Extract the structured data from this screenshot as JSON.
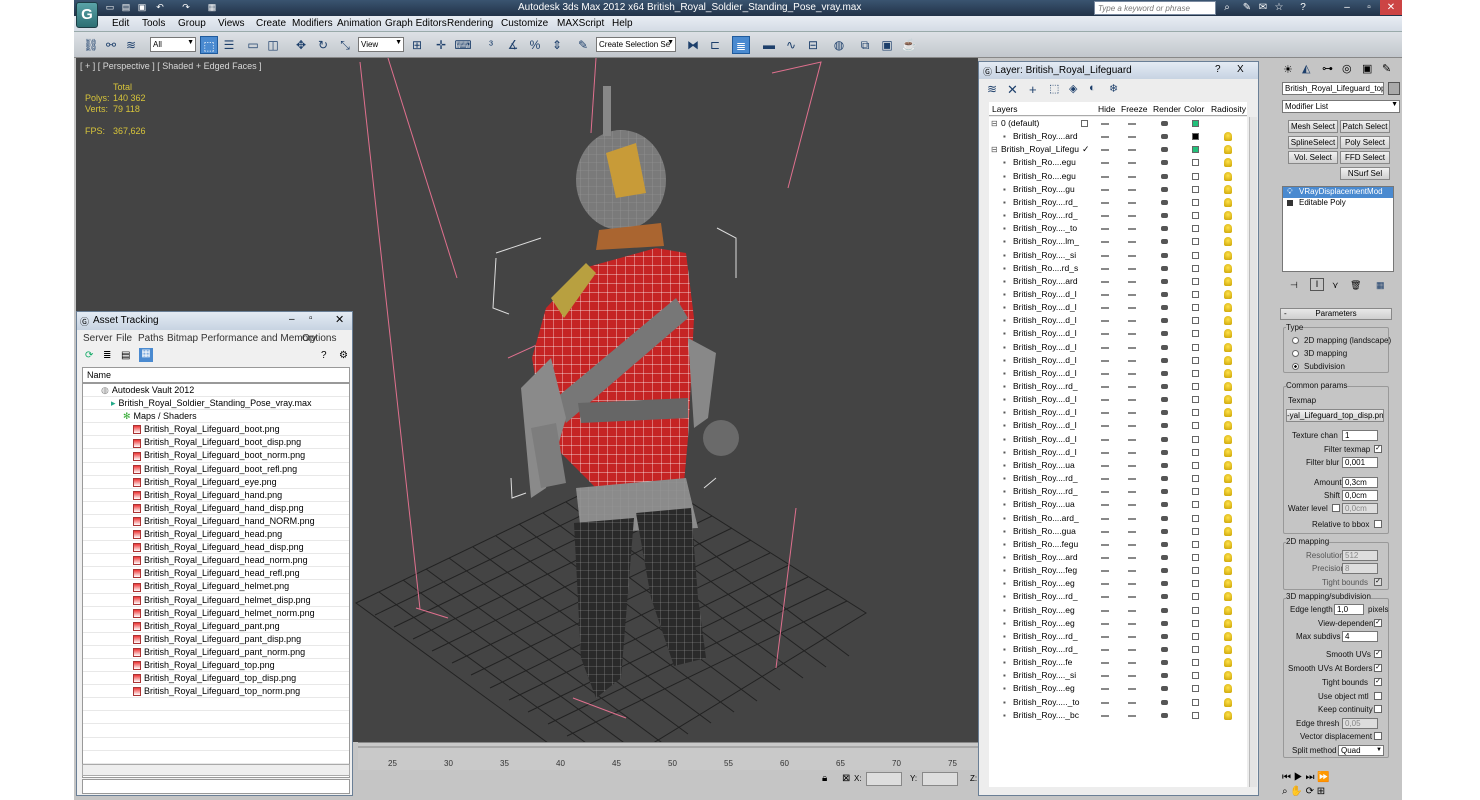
{
  "app": {
    "title": "Autodesk 3ds Max  2012 x64     British_Royal_Soldier_Standing_Pose_vray.max",
    "logo": "G",
    "search_placeholder": "Type a keyword or phrase"
  },
  "menu": [
    "Edit",
    "Tools",
    "Group",
    "Views",
    "Create",
    "Modifiers",
    "Animation",
    "Graph Editors",
    "Rendering",
    "Customize",
    "MAXScript",
    "Help"
  ],
  "toolbar": {
    "filter": "All",
    "coord": "View",
    "selset": "Create Selection Se"
  },
  "viewport": {
    "label": "[ + ] [ Perspective ] [ Shaded + Edged Faces ]",
    "total": "Total",
    "polys_label": "Polys:",
    "polys": "140 362",
    "verts_label": "Verts:",
    "verts": "79 118",
    "fps_label": "FPS:",
    "fps": "367,626"
  },
  "timeline": {
    "ticks": [
      "25",
      "30",
      "35",
      "40",
      "45",
      "50",
      "55",
      "60",
      "65",
      "70",
      "75"
    ]
  },
  "status": {
    "x_label": "X:",
    "y_label": "Y:",
    "z_label": "Z:"
  },
  "asset": {
    "title": "Asset Tracking",
    "menu": [
      "Server",
      "File",
      "Paths",
      "Bitmap Performance and Memory",
      "Options"
    ],
    "col": "Name",
    "vault": "Autodesk Vault 2012",
    "scene": "British_Royal_Soldier_Standing_Pose_vray.max",
    "maps": "Maps / Shaders",
    "files": [
      "British_Royal_Lifeguard_boot.png",
      "British_Royal_Lifeguard_boot_disp.png",
      "British_Royal_Lifeguard_boot_norm.png",
      "British_Royal_Lifeguard_boot_refl.png",
      "British_Royal_Lifeguard_eye.png",
      "British_Royal_Lifeguard_hand.png",
      "British_Royal_Lifeguard_hand_disp.png",
      "British_Royal_Lifeguard_hand_NORM.png",
      "British_Royal_Lifeguard_head.png",
      "British_Royal_Lifeguard_head_disp.png",
      "British_Royal_Lifeguard_head_norm.png",
      "British_Royal_Lifeguard_head_refl.png",
      "British_Royal_Lifeguard_helmet.png",
      "British_Royal_Lifeguard_helmet_disp.png",
      "British_Royal_Lifeguard_helmet_norm.png",
      "British_Royal_Lifeguard_pant.png",
      "British_Royal_Lifeguard_pant_disp.png",
      "British_Royal_Lifeguard_pant_norm.png",
      "British_Royal_Lifeguard_top.png",
      "British_Royal_Lifeguard_top_disp.png",
      "British_Royal_Lifeguard_top_norm.png"
    ]
  },
  "layer": {
    "title": "Layer: British_Royal_Lifeguard",
    "help": "?",
    "close": "X",
    "headers": {
      "layers": "Layers",
      "hide": "Hide",
      "freeze": "Freeze",
      "render": "Render",
      "color": "Color",
      "radiosity": "Radiosity"
    },
    "rows": [
      "0 (default)",
      "British_Roy....ard",
      "British_Royal_Lifegu",
      "British_Ro....egu",
      "British_Ro....egu",
      "British_Roy....gu",
      "British_Roy....rd_",
      "British_Roy....rd_",
      "British_Roy...._to",
      "British_Roy....lm_",
      "British_Roy...._si",
      "British_Ro....rd_s",
      "British_Roy....ard",
      "British_Roy....d_l",
      "British_Roy....d_l",
      "British_Roy....d_l",
      "British_Roy....d_l",
      "British_Roy....d_l",
      "British_Roy....d_l",
      "British_Roy....d_l",
      "British_Roy....rd_",
      "British_Roy....d_l",
      "British_Roy....d_l",
      "British_Roy....d_l",
      "British_Roy....d_l",
      "British_Roy....d_l",
      "British_Roy....ua",
      "British_Roy....rd_",
      "British_Roy....rd_",
      "British_Roy....ua",
      "British_Ro....ard_",
      "British_Ro....gua",
      "British_Ro....fegu",
      "British_Roy....ard",
      "British_Roy....feg",
      "British_Roy....eg",
      "British_Roy....rd_",
      "British_Roy....eg",
      "British_Roy....eg",
      "British_Roy....rd_",
      "British_Roy....rd_",
      "British_Roy....fe",
      "British_Roy...._si",
      "British_Roy....eg",
      "British_Roy....._to",
      "British_Roy...._bc"
    ]
  },
  "cmd": {
    "object": "British_Royal_Lifeguard_top",
    "modlist": "Modifier List",
    "buttons": [
      "Mesh Select",
      "Patch Select",
      "SplineSelect",
      "Poly Select",
      "Vol. Select",
      "FFD Select",
      "NSurf Sel"
    ],
    "stack": [
      "VRayDisplacementMod",
      "Editable Poly"
    ],
    "params": "Parameters",
    "type": "Type",
    "type_opts": [
      "2D mapping (landscape)",
      "3D mapping",
      "Subdivision"
    ],
    "common": "Common params",
    "texmap": "Texmap",
    "texmap_val": "-yal_Lifeguard_top_disp.png)",
    "texture_chan": "Texture chan",
    "texture_chan_val": "1",
    "filter_texmap": "Filter texmap",
    "filter_blur": "Filter blur",
    "filter_blur_val": "0,001",
    "amount": "Amount",
    "amount_val": "0,3cm",
    "shift": "Shift",
    "shift_val": "0,0cm",
    "water": "Water level",
    "water_val": "0,0cm",
    "relative": "Relative to bbox",
    "map2d": "2D mapping",
    "resolution": "Resolution",
    "resolution_val": "512",
    "precision": "Precision",
    "precision_val": "8",
    "tight": "Tight bounds",
    "map3d": "3D mapping/subdivision",
    "edge": "Edge length",
    "edge_val": "1,0",
    "pixels": "pixels",
    "viewdep": "View-dependent",
    "maxsub": "Max subdivs",
    "maxsub_val": "4",
    "smooth": "Smooth UVs",
    "smoothb": "Smooth UVs At Borders",
    "tight2": "Tight bounds",
    "useobj": "Use object mtl",
    "keep": "Keep continuity",
    "edgethresh": "Edge thresh",
    "edgethresh_val": "0,05",
    "vecdisp": "Vector displacement",
    "split": "Split method",
    "split_val": "Quad"
  }
}
